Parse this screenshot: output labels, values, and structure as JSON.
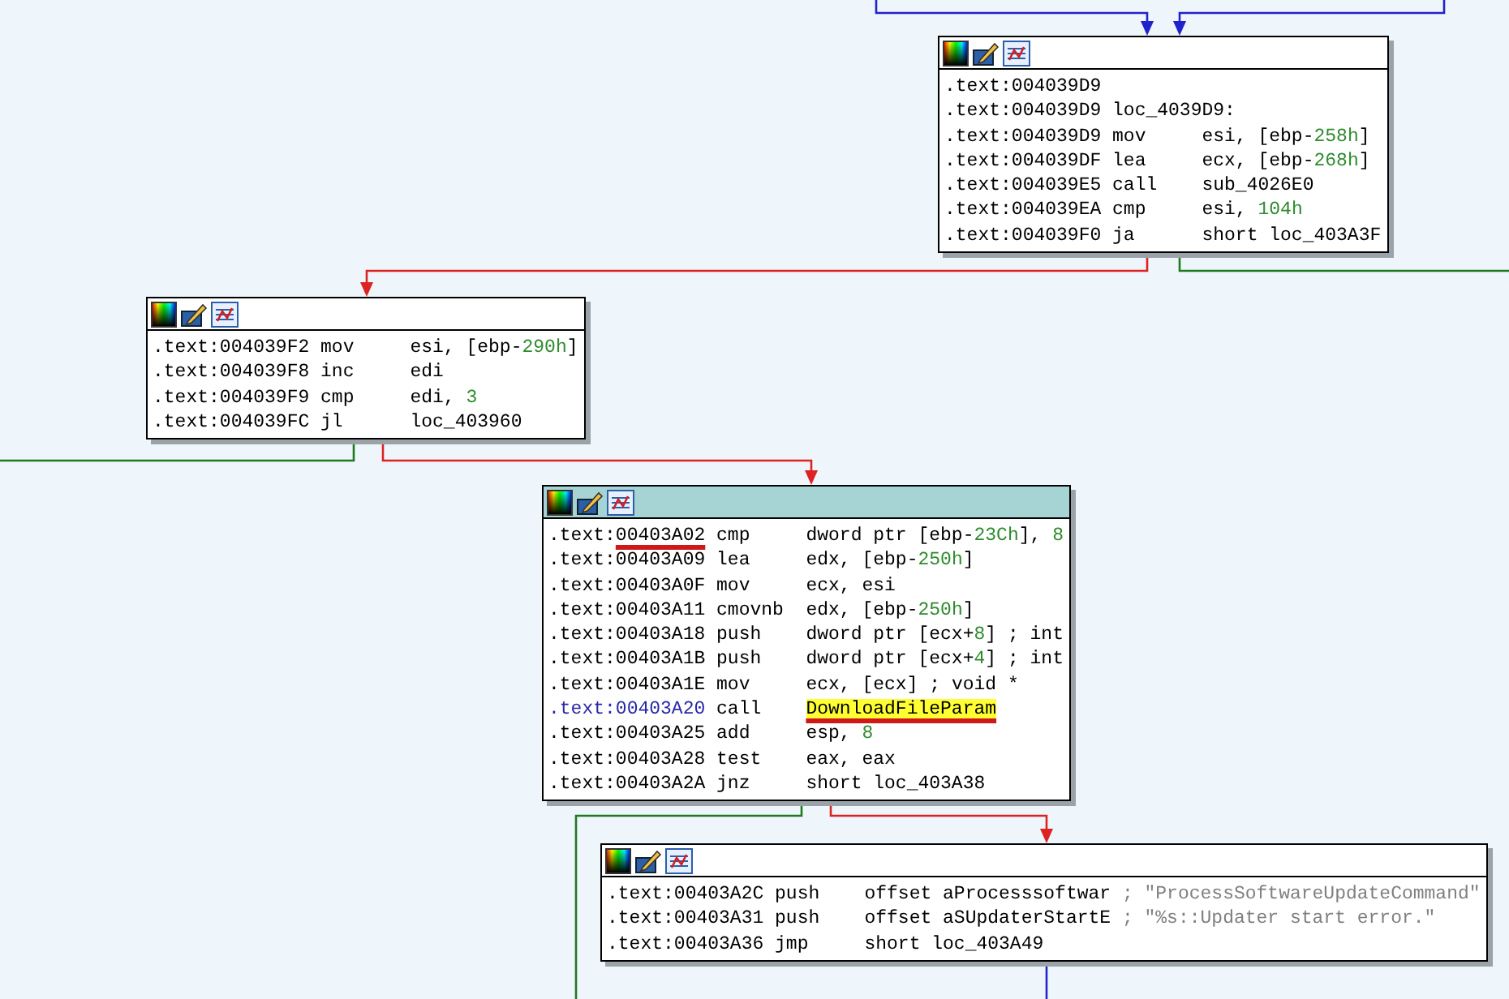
{
  "graph": {
    "nodes": [
      {
        "selected": false,
        "lines": [
          {
            "segment": ".text:",
            "address": "004039D9",
            "current": false,
            "highlighted": false,
            "address_underlined": false,
            "operand_underlined": false
          },
          {
            "segment": ".text:",
            "address": "004039D9",
            "mnemonic": "loc_4039D9:",
            "current": false,
            "highlighted": false,
            "address_underlined": false,
            "operand_underlined": false
          },
          {
            "segment": ".text:",
            "address": "004039D9",
            "mnemonic": "mov",
            "operand": "esi, [ebp-258h]",
            "current": false,
            "highlighted": false,
            "address_underlined": false,
            "operand_underlined": false
          },
          {
            "segment": ".text:",
            "address": "004039DF",
            "mnemonic": "lea",
            "operand": "ecx, [ebp-268h]",
            "current": false,
            "highlighted": false,
            "address_underlined": false,
            "operand_underlined": false
          },
          {
            "segment": ".text:",
            "address": "004039E5",
            "mnemonic": "call",
            "operand": "sub_4026E0",
            "current": false,
            "highlighted": false,
            "address_underlined": false,
            "operand_underlined": false
          },
          {
            "segment": ".text:",
            "address": "004039EA",
            "mnemonic": "cmp",
            "operand": "esi, 104h",
            "current": false,
            "highlighted": false,
            "address_underlined": false,
            "operand_underlined": false
          },
          {
            "segment": ".text:",
            "address": "004039F0",
            "mnemonic": "ja",
            "operand": "short loc_403A3F",
            "current": false,
            "highlighted": false,
            "address_underlined": false,
            "operand_underlined": false
          }
        ]
      },
      {
        "selected": false,
        "lines": [
          {
            "segment": ".text:",
            "address": "004039F2",
            "mnemonic": "mov",
            "operand": "esi, [ebp-290h]",
            "current": false,
            "highlighted": false,
            "address_underlined": false,
            "operand_underlined": false
          },
          {
            "segment": ".text:",
            "address": "004039F8",
            "mnemonic": "inc",
            "operand": "edi",
            "current": false,
            "highlighted": false,
            "address_underlined": false,
            "operand_underlined": false
          },
          {
            "segment": ".text:",
            "address": "004039F9",
            "mnemonic": "cmp",
            "operand": "edi, 3",
            "current": false,
            "highlighted": false,
            "address_underlined": false,
            "operand_underlined": false
          },
          {
            "segment": ".text:",
            "address": "004039FC",
            "mnemonic": "jl",
            "operand": "loc_403960",
            "current": false,
            "highlighted": false,
            "address_underlined": false,
            "operand_underlined": false
          }
        ]
      },
      {
        "selected": true,
        "lines": [
          {
            "segment": ".text:",
            "address": "00403A02",
            "mnemonic": "cmp",
            "operand": "dword ptr [ebp-23Ch], 8",
            "current": false,
            "highlighted": false,
            "address_underlined": true,
            "operand_underlined": false
          },
          {
            "segment": ".text:",
            "address": "00403A09",
            "mnemonic": "lea",
            "operand": "edx, [ebp-250h]",
            "current": false,
            "highlighted": false,
            "address_underlined": false,
            "operand_underlined": false
          },
          {
            "segment": ".text:",
            "address": "00403A0F",
            "mnemonic": "mov",
            "operand": "ecx, esi",
            "current": false,
            "highlighted": false,
            "address_underlined": false,
            "operand_underlined": false
          },
          {
            "segment": ".text:",
            "address": "00403A11",
            "mnemonic": "cmovnb",
            "operand": "edx, [ebp-250h]",
            "current": false,
            "highlighted": false,
            "address_underlined": false,
            "operand_underlined": false
          },
          {
            "segment": ".text:",
            "address": "00403A18",
            "mnemonic": "push",
            "operand": "dword ptr [ecx+8]",
            "comment": "; int",
            "current": false,
            "highlighted": false,
            "address_underlined": false,
            "operand_underlined": false
          },
          {
            "segment": ".text:",
            "address": "00403A1B",
            "mnemonic": "push",
            "operand": "dword ptr [ecx+4]",
            "comment": "; int",
            "current": false,
            "highlighted": false,
            "address_underlined": false,
            "operand_underlined": false
          },
          {
            "segment": ".text:",
            "address": "00403A1E",
            "mnemonic": "mov",
            "operand": "ecx, [ecx]",
            "comment": "; void *",
            "current": false,
            "highlighted": false,
            "address_underlined": false,
            "operand_underlined": false
          },
          {
            "segment": ".text:",
            "address": "00403A20",
            "mnemonic": "call",
            "operand": "DownloadFileParam",
            "current": true,
            "highlighted": true,
            "address_underlined": false,
            "operand_underlined": true
          },
          {
            "segment": ".text:",
            "address": "00403A25",
            "mnemonic": "add",
            "operand": "esp, 8",
            "current": false,
            "highlighted": false,
            "address_underlined": false,
            "operand_underlined": false
          },
          {
            "segment": ".text:",
            "address": "00403A28",
            "mnemonic": "test",
            "operand": "eax, eax",
            "current": false,
            "highlighted": false,
            "address_underlined": false,
            "operand_underlined": false
          },
          {
            "segment": ".text:",
            "address": "00403A2A",
            "mnemonic": "jnz",
            "operand": "short loc_403A38",
            "current": false,
            "highlighted": false,
            "address_underlined": false,
            "operand_underlined": false
          }
        ]
      },
      {
        "selected": false,
        "lines": [
          {
            "segment": ".text:",
            "address": "00403A2C",
            "mnemonic": "push",
            "operand": "offset aProcesssoftwar",
            "comment": "; \"ProcessSoftwareUpdateCommand\"",
            "current": false,
            "highlighted": false,
            "address_underlined": false,
            "operand_underlined": false
          },
          {
            "segment": ".text:",
            "address": "00403A31",
            "mnemonic": "push",
            "operand": "offset aSUpdaterStartE",
            "comment": "; \"%s::Updater start error.\"",
            "current": false,
            "highlighted": false,
            "address_underlined": false,
            "operand_underlined": false
          },
          {
            "segment": ".text:",
            "address": "00403A36",
            "mnemonic": "jmp",
            "operand": "short loc_403A49",
            "current": false,
            "highlighted": false,
            "address_underlined": false,
            "operand_underlined": false
          }
        ]
      }
    ],
    "edges": [
      {
        "kind": "jump"
      },
      {
        "kind": "jump"
      },
      {
        "kind": "false"
      },
      {
        "kind": "true"
      },
      {
        "kind": "true"
      },
      {
        "kind": "false"
      },
      {
        "kind": "false"
      },
      {
        "kind": "true"
      },
      {
        "kind": "jump"
      }
    ]
  }
}
